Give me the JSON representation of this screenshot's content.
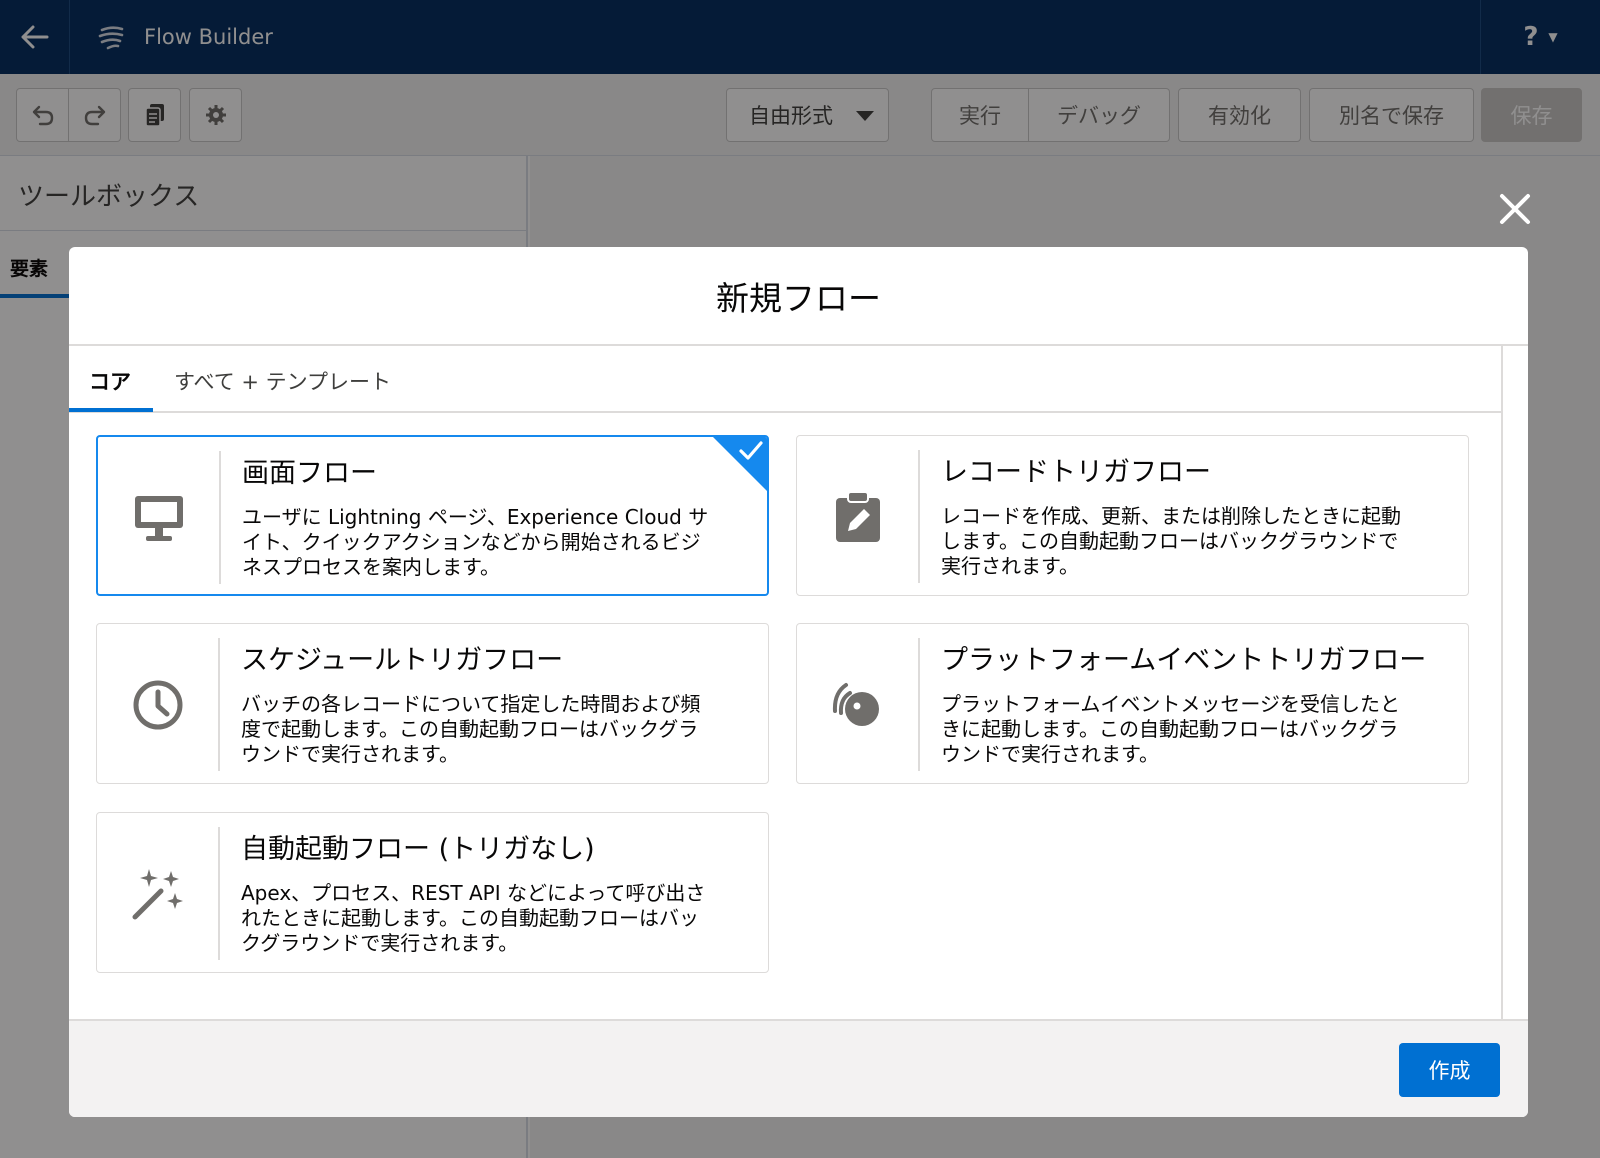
{
  "app": {
    "title": "Flow Builder",
    "help_label": "?"
  },
  "toolbar": {
    "mode_select": "自由形式",
    "run_label": "実行",
    "debug_label": "デバッグ",
    "activate_label": "有効化",
    "save_as_label": "別名で保存",
    "save_label": "保存"
  },
  "sidebar": {
    "title": "ツールボックス",
    "tab_label": "要素"
  },
  "modal": {
    "title": "新規フロー",
    "tabs": [
      {
        "label": "コア",
        "active": true
      },
      {
        "label": "すべて + テンプレート",
        "active": false
      }
    ],
    "cards": [
      {
        "title": "画面フロー",
        "description": "ユーザに Lightning ページ、Experience Cloud サイト、クイックアクションなどから開始されるビジネスプロセスを案内します。",
        "icon": "desktop-icon",
        "selected": true
      },
      {
        "title": "レコードトリガフロー",
        "description": "レコードを作成、更新、または削除したときに起動します。この自動起動フローはバックグラウンドで実行されます。",
        "icon": "clipboard-edit-icon",
        "selected": false
      },
      {
        "title": "スケジュールトリガフロー",
        "description": "バッチの各レコードについて指定した時間および頻度で起動します。この自動起動フローはバックグラウンドで実行されます。",
        "icon": "clock-icon",
        "selected": false
      },
      {
        "title": "プラットフォームイベントトリガフロー",
        "description": "プラットフォームイベントメッセージを受信したときに起動します。この自動起動フローはバックグラウンドで実行されます。",
        "icon": "broadcast-icon",
        "selected": false
      },
      {
        "title": "自動起動フロー (トリガなし)",
        "description": "Apex、プロセス、REST API などによって呼び出されたときに起動します。この自動起動フローはバックグラウンドで実行されます。",
        "icon": "magic-wand-icon",
        "selected": false
      }
    ],
    "create_label": "作成"
  },
  "colors": {
    "header_bg": "#032d60",
    "brand": "#0070d2",
    "selected_border": "#1589ee"
  }
}
